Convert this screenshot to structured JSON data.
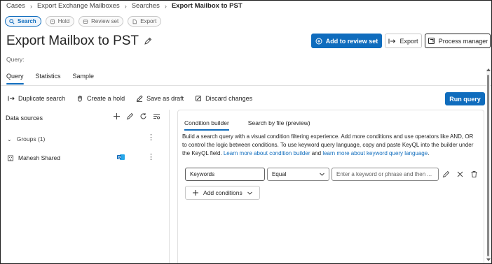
{
  "breadcrumb": {
    "items": [
      "Cases",
      "Export Exchange Mailboxes",
      "Searches"
    ],
    "current": "Export Mailbox to PST"
  },
  "steps": [
    {
      "label": "Search",
      "icon": "search-icon",
      "active": true
    },
    {
      "label": "Hold",
      "icon": "hold-icon",
      "active": false
    },
    {
      "label": "Review set",
      "icon": "review-set-icon",
      "active": false
    },
    {
      "label": "Export",
      "icon": "export-icon",
      "active": false
    }
  ],
  "page": {
    "title": "Export Mailbox to PST",
    "query_label": "Query:"
  },
  "actions": {
    "add_to_review_set": "Add to review set",
    "export": "Export",
    "process_manager": "Process manager",
    "run_query": "Run query"
  },
  "tabs": [
    "Query",
    "Statistics",
    "Sample"
  ],
  "toolbar": {
    "duplicate_search": "Duplicate search",
    "create_hold": "Create a hold",
    "save_as_draft": "Save as draft",
    "discard_changes": "Discard changes"
  },
  "data_sources": {
    "title": "Data sources",
    "groups_label": "Groups (1)",
    "mailbox_name": "Mahesh Shared"
  },
  "condition_builder": {
    "tabs": [
      "Condition builder",
      "Search by file (preview)"
    ],
    "description_prefix": "Build a search query with a visual condition filtering experience. Add more conditions and use operators like AND, OR to control the logic between conditions. To use keyword query language, copy and paste KeyQL into the builder under the KeyQL field.",
    "link_condition_builder": "Learn more about condition builder",
    "and_text": "and",
    "link_keyword_query": "learn more about keyword query language",
    "keywords_field": "Keywords",
    "operator_value": "Equal",
    "keyword_placeholder": "Enter a keyword or phrase and then ...",
    "add_conditions": "Add conditions"
  },
  "colors": {
    "accent": "#0f6cbd",
    "text": "#242424",
    "outlook_blue": "#0364b8"
  }
}
